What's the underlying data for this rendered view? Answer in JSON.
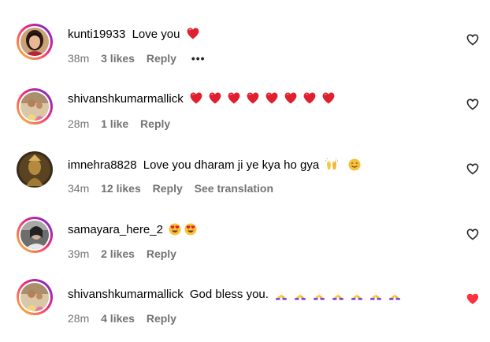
{
  "comments": [
    {
      "username": "kunti19933",
      "text": "Love you",
      "time": "38m",
      "likes": "3 likes",
      "reply": "Reply",
      "more": "•••",
      "trailing_emoji": "red-heart",
      "liked": false
    },
    {
      "username": "shivanshkumarmallick",
      "text": "",
      "time": "28m",
      "likes": "1 like",
      "reply": "Reply",
      "trailing_emoji": "red-heart x8",
      "liked": false
    },
    {
      "username": "imnehra8828",
      "text": "Love you dharam ji ye kya ho gya",
      "time": "34m",
      "likes": "12 likes",
      "reply": "Reply",
      "translation": "See translation",
      "trailing_emoji": "raising-hands, smiling-face",
      "liked": false
    },
    {
      "username": "samayara_here_2",
      "text": "",
      "time": "39m",
      "likes": "2 likes",
      "reply": "Reply",
      "trailing_emoji": "heart-eyes x2",
      "liked": false
    },
    {
      "username": "shivanshkumarmallick",
      "text": "God bless you.",
      "time": "28m",
      "likes": "4 likes",
      "reply": "Reply",
      "trailing_emoji": "folded-hands x7",
      "liked": true
    }
  ],
  "colors": {
    "text": "#000000",
    "meta": "#737373",
    "liked_heart": "#ff3040",
    "emoji_heart": "#e0202f"
  }
}
